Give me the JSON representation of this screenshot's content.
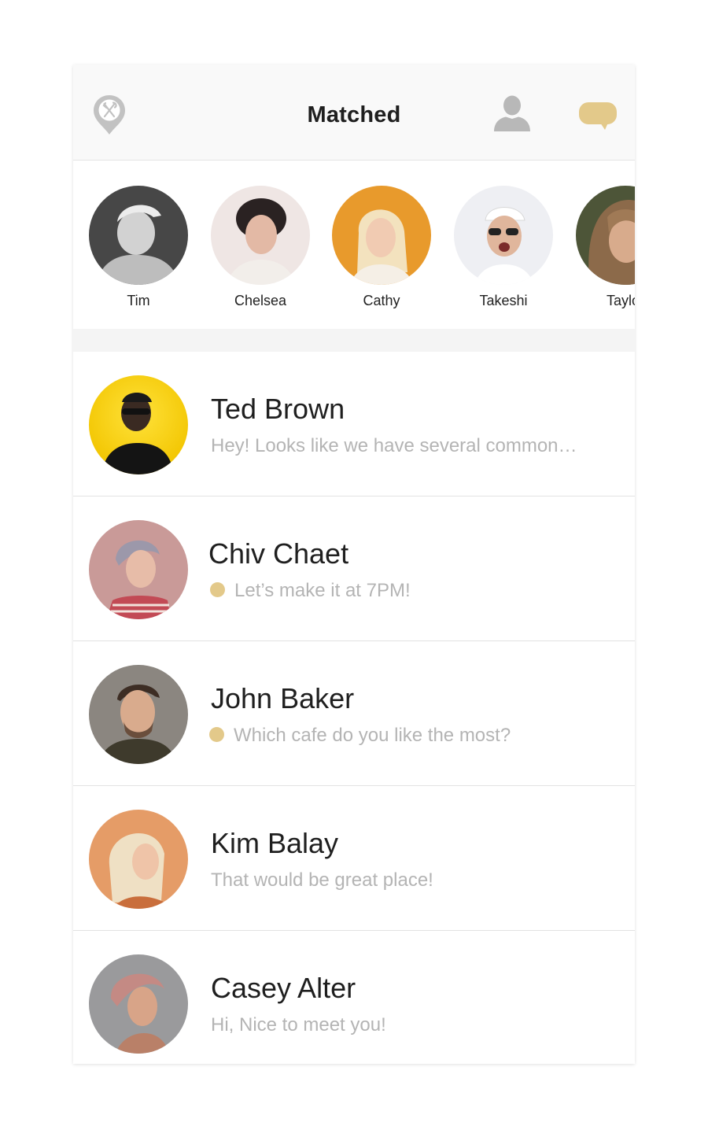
{
  "header": {
    "title": "Matched",
    "left_icon": "location-pin-fork-knife-icon",
    "profile_icon": "user-icon",
    "chat_icon": "chat-bubble-icon"
  },
  "colors": {
    "accent": "#e3c98a",
    "header_bg": "#f9f9f9",
    "muted_text": "#b4b4b4",
    "icon_gray": "#b8b8b8"
  },
  "matches": [
    {
      "name": "Tim"
    },
    {
      "name": "Chelsea"
    },
    {
      "name": "Cathy"
    },
    {
      "name": "Takeshi"
    },
    {
      "name": "Taylor"
    }
  ],
  "conversations": [
    {
      "name": "Ted Brown",
      "message": "Hey! Looks like we have several common…",
      "unread": false
    },
    {
      "name": "Chiv Chaet",
      "message": "Let’s make it at 7PM!",
      "unread": true
    },
    {
      "name": "John Baker",
      "message": "Which cafe do you like the most?",
      "unread": true
    },
    {
      "name": "Kim Balay",
      "message": "That would be great place!",
      "unread": false
    },
    {
      "name": "Casey Alter",
      "message": "Hi, Nice to meet you!",
      "unread": false
    }
  ]
}
